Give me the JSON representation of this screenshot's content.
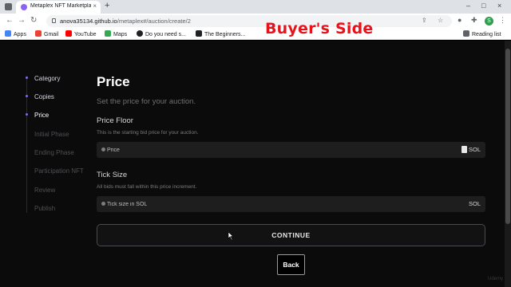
{
  "browser": {
    "tab_title": "Metaplex NFT Marketplace",
    "tab_close": "×",
    "new_tab": "+",
    "url_host": "anova35134.github.io",
    "url_path": "/metaplex#/auction/create/2",
    "profile_initial": "S",
    "window_controls": [
      "–",
      "□",
      "×"
    ]
  },
  "bookmarks": [
    {
      "label": "Apps",
      "color": "#4285f4"
    },
    {
      "label": "Gmail",
      "color": "#ea4335"
    },
    {
      "label": "YouTube",
      "color": "#ff0000"
    },
    {
      "label": "Maps",
      "color": "#34a853"
    },
    {
      "label": "Do you need s...",
      "color": "#202124"
    },
    {
      "label": "The Beginners...",
      "color": "#202124"
    }
  ],
  "reading_list": "Reading list",
  "overlay_title": "Buyer's Side",
  "steps": [
    {
      "label": "Category",
      "state": "done"
    },
    {
      "label": "Copies",
      "state": "done"
    },
    {
      "label": "Price",
      "state": "active"
    },
    {
      "label": "Initial Phase",
      "state": "pending"
    },
    {
      "label": "Ending Phase",
      "state": "pending"
    },
    {
      "label": "Participation NFT",
      "state": "pending"
    },
    {
      "label": "Review",
      "state": "pending"
    },
    {
      "label": "Publish",
      "state": "pending"
    }
  ],
  "main": {
    "title": "Price",
    "subtitle": "Set the price for your auction.",
    "price_floor": {
      "label": "Price Floor",
      "hint": "This is the starting bid price for your auction.",
      "placeholder": "Price",
      "suffix": "SOL"
    },
    "tick_size": {
      "label": "Tick Size",
      "hint": "All bids must fall within this price increment.",
      "placeholder": "Tick size in SOL",
      "suffix": "SOL"
    },
    "continue_label": "CONTINUE",
    "back_label": "Back"
  },
  "watermark": "Udemy",
  "colors": {
    "accent": "#7b6ff0",
    "background": "#0b0b0b",
    "overlay_title": "#e8121a"
  }
}
